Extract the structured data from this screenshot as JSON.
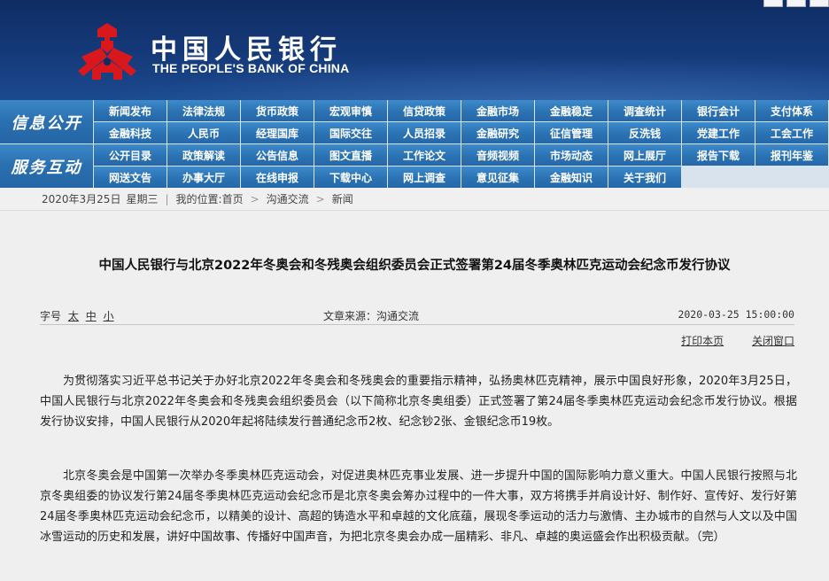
{
  "header": {
    "logo_cn": "中国人民银行",
    "logo_en": "THE PEOPLE'S BANK OF CHINA",
    "colors": {
      "banner": "#153a7a",
      "logo_red": "#d9181e"
    }
  },
  "nav": {
    "info_label": "信息公开",
    "info_rows": [
      [
        "新闻发布",
        "法律法规",
        "货币政策",
        "宏观审慎",
        "信贷政策",
        "金融市场",
        "金融稳定",
        "调查统计",
        "银行会计",
        "支付体系"
      ],
      [
        "金融科技",
        "人民币",
        "经理国库",
        "国际交往",
        "人员招录",
        "金融研究",
        "征信管理",
        "反洗钱",
        "党建工作",
        "工会工作"
      ]
    ],
    "service_label": "服务互动",
    "service_rows": [
      [
        "公开目录",
        "政策解读",
        "公告信息",
        "图文直播",
        "工作论文",
        "音频视频",
        "市场动态",
        "网上展厅",
        "报告下载",
        "报刊年鉴"
      ],
      [
        "网送文告",
        "办事大厅",
        "在线申报",
        "下载中心",
        "网上调查",
        "意见征集",
        "金融知识",
        "关于我们"
      ]
    ]
  },
  "breadcrumb": {
    "date": "2020年3月25日",
    "weekday": "星期三",
    "location_label": "我的位置:",
    "home": "首页",
    "section": "沟通交流",
    "current": "新闻",
    "sep": "|",
    "arrow": ">"
  },
  "article": {
    "title": "中国人民银行与北京2022年冬奥会和冬残奥会组织委员会正式签署第24届冬季奥林匹克运动会纪念币发行协议",
    "font_size_label": "字号",
    "font_sizes": [
      "太",
      "中",
      "小"
    ],
    "source": "文章来源：沟通交流",
    "date": "2020-03-25 15:00:00",
    "print_label": "打印本页",
    "close_label": "关闭窗口",
    "paragraphs": [
      "为贯彻落实习近平总书记关于办好北京2022年冬奥会和冬残奥会的重要指示精神，弘扬奥林匹克精神，展示中国良好形象，2020年3月25日，中国人民银行与北京2022年冬奥会和冬残奥会组织委员会（以下简称北京冬奥组委）正式签署了第24届冬季奥林匹克运动会纪念币发行协议。根据发行协议安排，中国人民银行从2020年起将陆续发行普通纪念币2枚、纪念钞2张、金银纪念币19枚。",
      "北京冬奥会是中国第一次举办冬季奥林匹克运动会，对促进奥林匹克事业发展、进一步提升中国的国际影响力意义重大。中国人民银行按照与北京冬奥组委的协议发行第24届冬季奥林匹克运动会纪念币是北京冬奥会筹办过程中的一件大事，双方将携手并肩设计好、制作好、宣传好、发行好第24届冬季奥林匹克运动会纪念币，以精美的设计、高超的铸造水平和卓越的文化底蕴，展现冬季运动的活力与激情、主办城市的自然与人文以及中国冰雪运动的历史和发展，讲好中国故事、传播好中国声音，为把北京冬奥会办成一届精彩、非凡、卓越的奥运盛会作出积极贡献。（完）"
    ]
  }
}
